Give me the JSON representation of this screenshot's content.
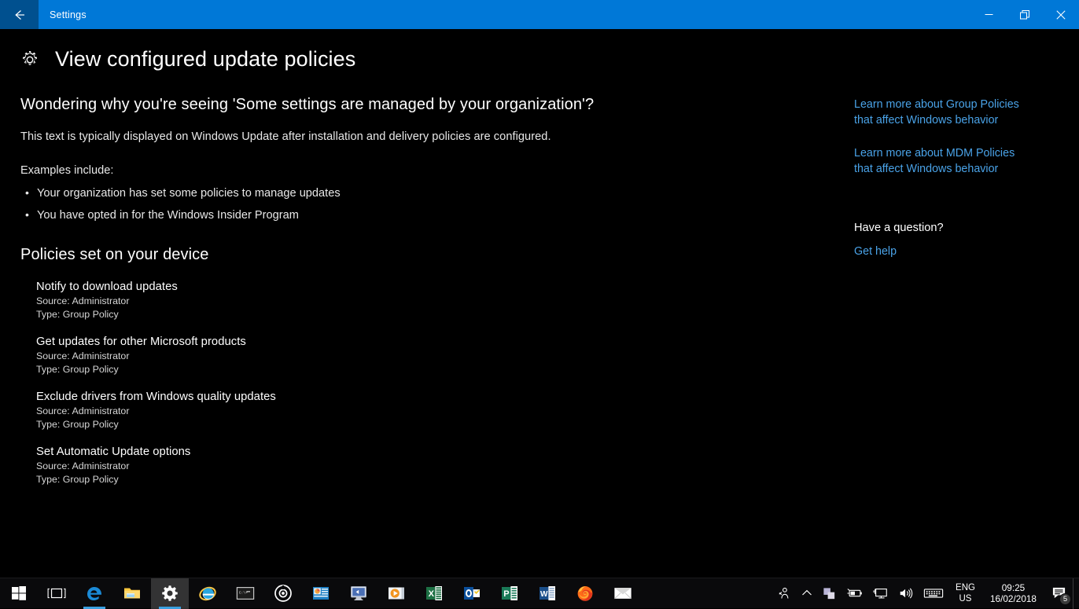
{
  "window": {
    "title": "Settings",
    "back_icon": "back-arrow-icon",
    "controls": {
      "minimize": "minimize-icon",
      "restore": "restore-icon",
      "close": "close-icon"
    },
    "accent_color": "#0078d7",
    "back_button_color": "#00508f"
  },
  "page": {
    "gear_icon": "gear-icon",
    "title": "View configured update policies"
  },
  "main": {
    "intro_heading": "Wondering why you're seeing 'Some settings are managed by your organization'?",
    "intro_text": "This text is typically displayed on Windows Update after installation and delivery policies are configured.",
    "examples_label": "Examples include:",
    "examples": [
      "Your organization has set some policies to manage updates",
      "You have opted in for the Windows Insider Program"
    ],
    "policies_heading": "Policies set on your device",
    "policies": [
      {
        "name": "Notify to download updates",
        "source": "Source: Administrator",
        "type": "Type: Group Policy"
      },
      {
        "name": "Get updates for other Microsoft products",
        "source": "Source: Administrator",
        "type": "Type: Group Policy"
      },
      {
        "name": "Exclude drivers from Windows quality updates",
        "source": "Source: Administrator",
        "type": "Type: Group Policy"
      },
      {
        "name": "Set Automatic Update options",
        "source": "Source: Administrator",
        "type": "Type: Group Policy"
      }
    ]
  },
  "sidebar": {
    "link_group_policies": "Learn more about Group Policies that affect Windows behavior",
    "link_mdm_policies": "Learn more about MDM Policies that affect Windows behavior",
    "have_question_heading": "Have a question?",
    "get_help": "Get help",
    "link_color": "#4aa3e8"
  },
  "taskbar": {
    "items": [
      {
        "name": "start-button",
        "icon": "windows-logo-icon",
        "state": "idle"
      },
      {
        "name": "task-view-button",
        "icon": "task-view-icon",
        "state": "idle"
      },
      {
        "name": "taskbar-microsoft-edge",
        "icon": "edge-icon",
        "state": "running"
      },
      {
        "name": "taskbar-file-explorer",
        "icon": "folder-icon",
        "state": "idle"
      },
      {
        "name": "taskbar-settings",
        "icon": "gear-icon",
        "state": "active"
      },
      {
        "name": "taskbar-internet-explorer",
        "icon": "internet-explorer-icon",
        "state": "idle"
      },
      {
        "name": "taskbar-command-prompt",
        "icon": "command-prompt-icon",
        "state": "idle"
      },
      {
        "name": "taskbar-media-player",
        "icon": "target-disc-icon",
        "state": "idle"
      },
      {
        "name": "taskbar-powerpoint-viewer",
        "icon": "presentation-icon",
        "state": "idle"
      },
      {
        "name": "taskbar-remote-desktop",
        "icon": "monitor-icon",
        "state": "idle"
      },
      {
        "name": "taskbar-movies-and-tv",
        "icon": "play-button-icon",
        "state": "idle"
      },
      {
        "name": "taskbar-excel",
        "icon": "excel-icon",
        "state": "idle"
      },
      {
        "name": "taskbar-outlook",
        "icon": "outlook-icon",
        "state": "idle"
      },
      {
        "name": "taskbar-publisher",
        "icon": "publisher-icon",
        "state": "idle"
      },
      {
        "name": "taskbar-word",
        "icon": "word-icon",
        "state": "idle"
      },
      {
        "name": "taskbar-firefox",
        "icon": "firefox-icon",
        "state": "idle"
      },
      {
        "name": "taskbar-mail",
        "icon": "envelope-icon",
        "state": "idle"
      }
    ],
    "tray": {
      "people": "people-icon",
      "show_hidden": "chevron-up-icon",
      "onedrive": "overlapping-squares-icon",
      "battery": "battery-icon",
      "network": "network-monitor-icon",
      "volume": "speaker-icon",
      "keyboard": "keyboard-icon"
    },
    "language": {
      "line1": "ENG",
      "line2": "US"
    },
    "clock": {
      "time": "09:25",
      "date": "16/02/2018"
    },
    "action_center": {
      "icon": "action-center-icon",
      "badge": "5"
    }
  }
}
